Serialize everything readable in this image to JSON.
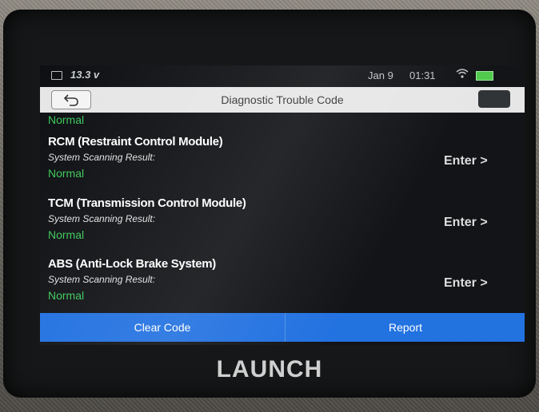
{
  "statusbar": {
    "voltage": "13.3 v",
    "date": "Jan 9",
    "time": "01:31",
    "wifi_icon": "wifi-icon",
    "battery_color": "#4ec94a"
  },
  "titlebar": {
    "title": "Diagnostic Trouble Code",
    "back_icon": "back-arrow-icon"
  },
  "list": {
    "top_status": "Normal",
    "items": [
      {
        "title": "RCM (Restraint Control Module)",
        "subtitle": "System Scanning Result:",
        "status": "Normal",
        "action": "Enter >"
      },
      {
        "title": "TCM (Transmission Control Module)",
        "subtitle": "System Scanning Result:",
        "status": "Normal",
        "action": "Enter >"
      },
      {
        "title": "ABS (Anti-Lock Brake System)",
        "subtitle": "System Scanning Result:",
        "status": "Normal",
        "action": "Enter >"
      }
    ]
  },
  "actions": {
    "clear_code": "Clear Code",
    "report": "Report",
    "accent_color": "#1e6fe0"
  },
  "device": {
    "brand": "LAUNCH"
  }
}
